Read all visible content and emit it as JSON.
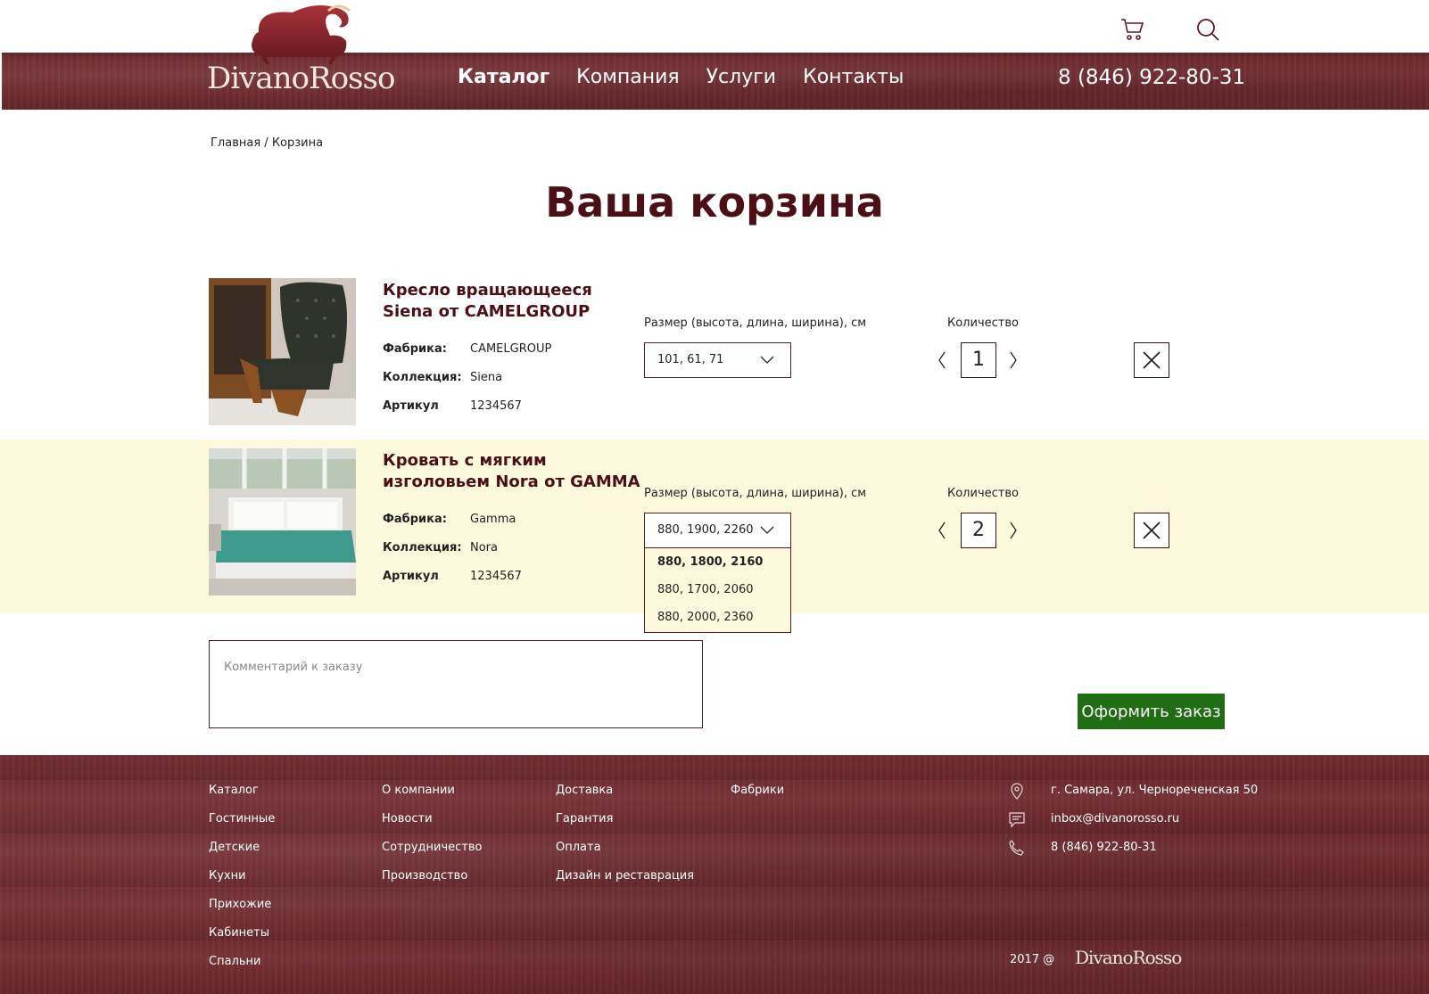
{
  "brand": {
    "name": "DivanoRosso"
  },
  "icons": {
    "cart": "cart-icon",
    "search": "search-icon"
  },
  "nav": {
    "items": [
      {
        "label": "Каталог",
        "active": true
      },
      {
        "label": "Компания",
        "active": false
      },
      {
        "label": "Услуги",
        "active": false
      },
      {
        "label": "Контакты",
        "active": false
      }
    ],
    "phone": "8 (846) 922-80-31"
  },
  "breadcrumb": {
    "home": "Главная",
    "separator": "/",
    "current": "Корзина"
  },
  "page": {
    "title": "Ваша корзина"
  },
  "cart": {
    "labels": {
      "factory": "Фабрика:",
      "collection": "Коллекция:",
      "article": "Артикул",
      "size": "Размер (высота, длина, ширина), см",
      "quantity": "Количество"
    },
    "items": [
      {
        "title": "Кресло вращающееся Siena от CAMELGROUP",
        "factory": "CAMELGROUP",
        "collection": "Siena",
        "article": "1234567",
        "size": "101, 61, 71",
        "quantity": "1",
        "highlighted": false
      },
      {
        "title": "Кровать с мягким изголовьем Nora от GAMMA",
        "factory": "Gamma",
        "collection": "Nora",
        "article": "1234567",
        "size": "880, 1900, 2260",
        "quantity": "2",
        "highlighted": true,
        "size_options": [
          "880, 1800, 2160",
          "880, 1700, 2060",
          "880, 2000, 2360"
        ]
      }
    ]
  },
  "comment": {
    "placeholder": "Комментарий к заказу"
  },
  "order_button": "Оформить заказ",
  "footer": {
    "col1": [
      "Каталог",
      "Гостинные",
      "Детские",
      "Кухни",
      "Прихожие",
      "Кабинеты",
      "Спальни"
    ],
    "col2": [
      "О компании",
      "Новости",
      "Сотрудничество",
      "Производство"
    ],
    "col3": [
      "Доставка",
      "Гарантия",
      "Оплата",
      "Дизайн и реставрация"
    ],
    "col4": [
      "Фабрики"
    ],
    "contacts": {
      "address": "г. Самара, ул. Чернореченская 50",
      "email": "inbox@divanorosso.ru",
      "phone": "8 (846) 922-80-31"
    },
    "copyright": "2017 @",
    "logo": "DivanoRosso"
  },
  "colors": {
    "brand_wood": "#6e2a2e",
    "title": "#4a1016",
    "highlight_row": "#fdf9dc",
    "order_button": "#1f6e14"
  }
}
